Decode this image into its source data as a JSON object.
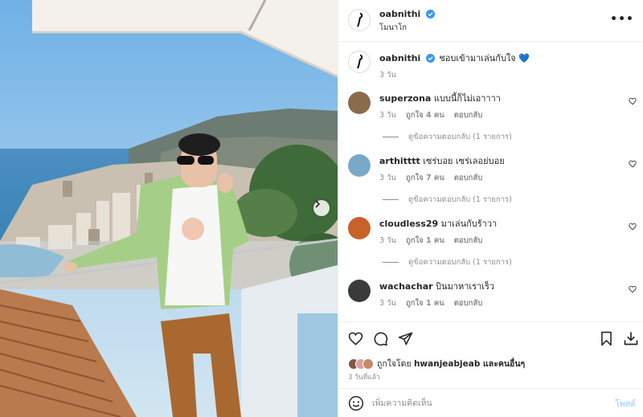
{
  "post": {
    "username": "oabnithi",
    "location": "โมนาโก",
    "caption": "ชอบเข้ามาเล่นกับใจ 💙",
    "caption_age": "3 วัน",
    "verified_icon": "verified-badge-icon",
    "more_label": "•••"
  },
  "comments": [
    {
      "username": "superzona",
      "text": "แบบนี้ก็ไม่เอาาาา",
      "age": "3 วัน",
      "likes": "ถูกใจ 4 คน",
      "reply": "ตอบกลับ",
      "view_replies": "ดูข้อความตอบกลับ (1 รายการ)"
    },
    {
      "username": "arthitttt",
      "text": "เซร่บอย เซร่เลอย่บอย",
      "age": "3 วัน",
      "likes": "ถูกใจ 7 คน",
      "reply": "ตอบกลับ",
      "view_replies": "ดูข้อความตอบกลับ (1 รายการ)"
    },
    {
      "username": "cloudless29",
      "text": "มาเล่นกับร้าวา",
      "age": "3 วัน",
      "likes": "ถูกใจ 1 คน",
      "reply": "ตอบกลับ",
      "view_replies": "ดูข้อความตอบกลับ (1 รายการ)"
    },
    {
      "username": "wachachar",
      "text": "บินมาหาเราเร็ว",
      "age": "3 วัน",
      "likes": "ถูกใจ 1 คน",
      "reply": "ตอบกลับ"
    }
  ],
  "likes_summary": {
    "prefix": "ถูกใจโดย ",
    "user": "hwanjeabjeab",
    "suffix": " และคนอื่นๆ"
  },
  "post_date": "3 วันที่แล้ว",
  "add_comment": {
    "placeholder": "เพิ่มความคิดเห็น",
    "post_label": "โพสต์"
  },
  "colors": {
    "verified": "#3897f0",
    "muted": "#8e8e8e",
    "post_button_disabled": "#b3dbff"
  }
}
